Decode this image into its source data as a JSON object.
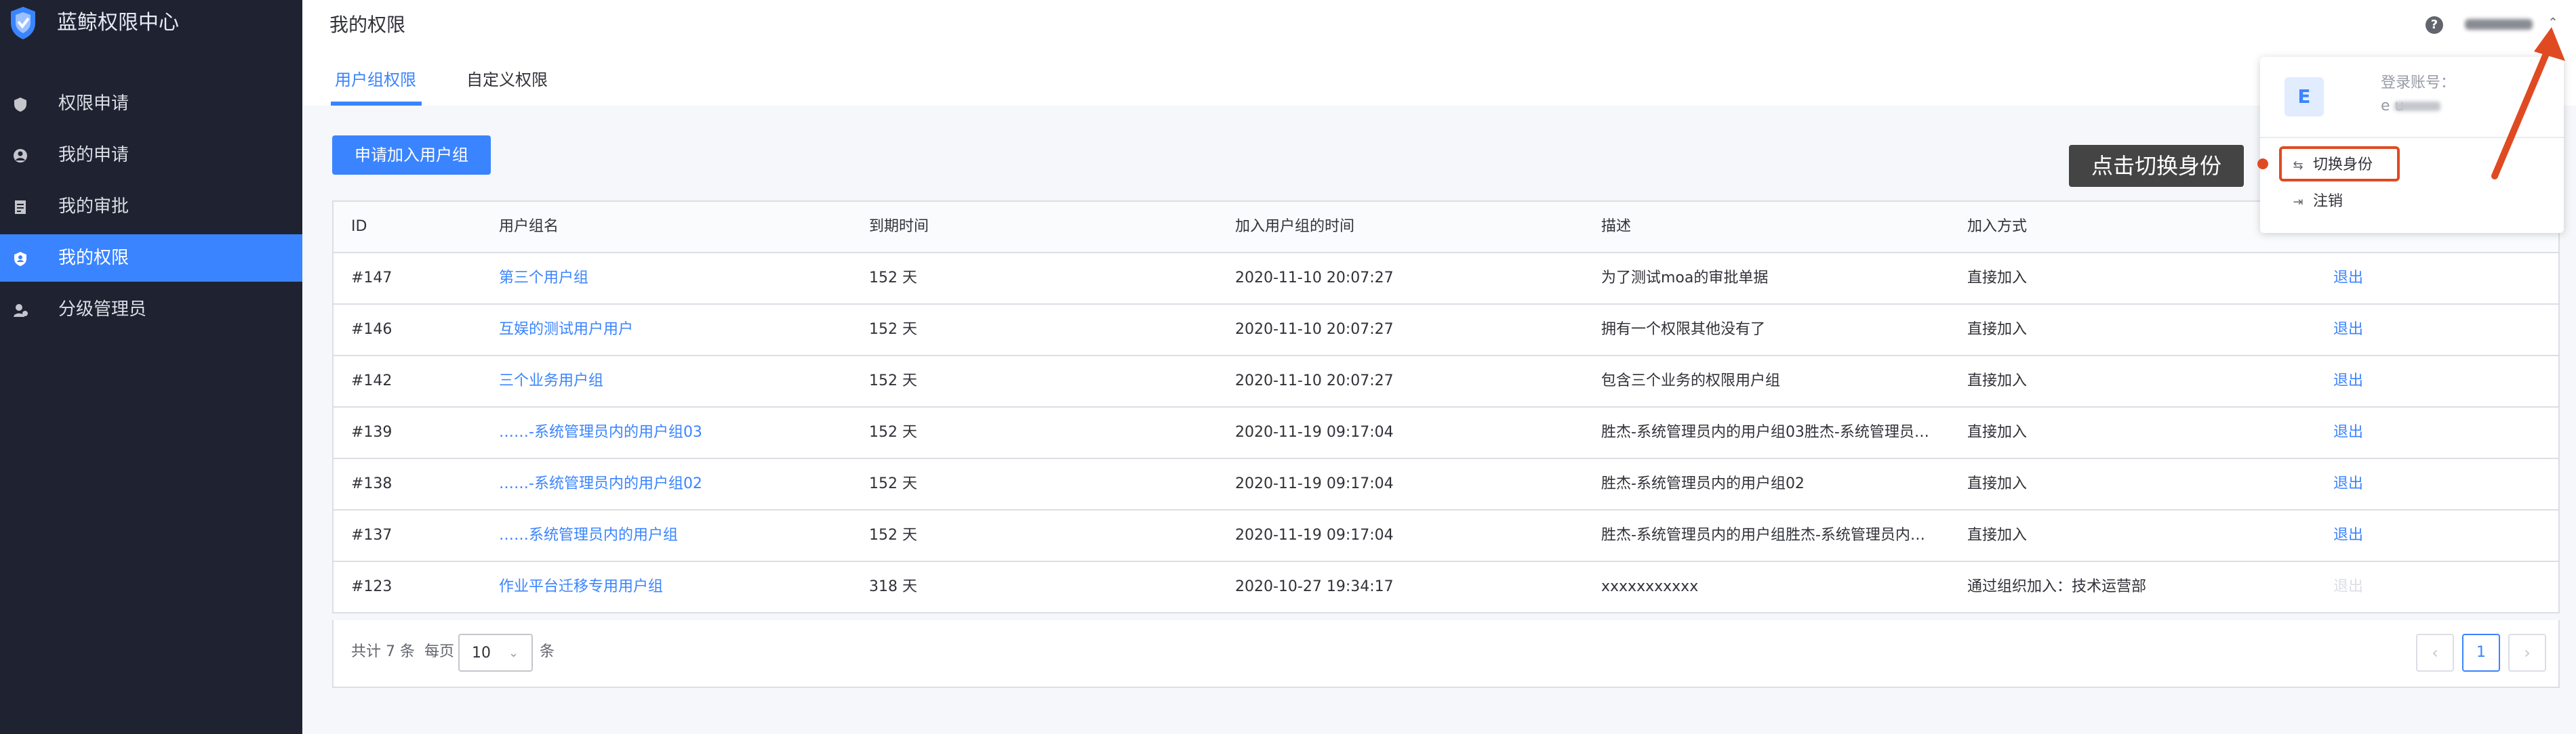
{
  "sidebar": {
    "brand_title": "蓝鲸权限中心",
    "items": [
      {
        "label": "权限申请",
        "icon": "shield-icon"
      },
      {
        "label": "我的申请",
        "icon": "user-circle-icon"
      },
      {
        "label": "我的审批",
        "icon": "document-icon"
      },
      {
        "label": "我的权限",
        "icon": "shield-user-icon",
        "active": true
      },
      {
        "label": "分级管理员",
        "icon": "admin-icon"
      }
    ]
  },
  "header": {
    "page_title": "我的权限",
    "tabs": [
      {
        "label": "用户组权限",
        "active": true
      },
      {
        "label": "自定义权限",
        "active": false
      }
    ],
    "help_glyph": "?"
  },
  "actions": {
    "apply_button": "申请加入用户组"
  },
  "table": {
    "columns": [
      "ID",
      "用户组名",
      "到期时间",
      "加入用户组的时间",
      "描述",
      "加入方式"
    ],
    "rows": [
      {
        "id": "#147",
        "name": "第三个用户组",
        "expire": "152 天",
        "joined": "2020-11-10 20:07:27",
        "desc": "为了测试moa的审批单据",
        "method": "直接加入",
        "action": "退出",
        "action_enabled": true
      },
      {
        "id": "#146",
        "name": "互娱的测试用户用户",
        "expire": "152 天",
        "joined": "2020-11-10 20:07:27",
        "desc": "拥有一个权限其他没有了",
        "method": "直接加入",
        "action": "退出",
        "action_enabled": true
      },
      {
        "id": "#142",
        "name": "三个业务用户组",
        "expire": "152 天",
        "joined": "2020-11-10 20:07:27",
        "desc": "包含三个业务的权限用户组",
        "method": "直接加入",
        "action": "退出",
        "action_enabled": true
      },
      {
        "id": "#139",
        "name": "……-系统管理员内的用户组03",
        "expire": "152 天",
        "joined": "2020-11-19 09:17:04",
        "desc": "胜杰-系统管理员内的用户组03胜杰-系统管理员…",
        "method": "直接加入",
        "action": "退出",
        "action_enabled": true
      },
      {
        "id": "#138",
        "name": "……-系统管理员内的用户组02",
        "expire": "152 天",
        "joined": "2020-11-19 09:17:04",
        "desc": "胜杰-系统管理员内的用户组02",
        "method": "直接加入",
        "action": "退出",
        "action_enabled": true
      },
      {
        "id": "#137",
        "name": "……系统管理员内的用户组",
        "expire": "152 天",
        "joined": "2020-11-19 09:17:04",
        "desc": "胜杰-系统管理员内的用户组胜杰-系统管理员内…",
        "method": "直接加入",
        "action": "退出",
        "action_enabled": true
      },
      {
        "id": "#123",
        "name": "作业平台迁移专用用户组",
        "expire": "318 天",
        "joined": "2020-10-27 19:34:17",
        "desc": "xxxxxxxxxxx",
        "method": "通过组织加入：技术运营部",
        "action": "退出",
        "action_enabled": false
      }
    ]
  },
  "pagination": {
    "total_prefix": "共计",
    "total_count": "7",
    "total_suffix": "条",
    "per_page_label": "每页",
    "page_size": "10",
    "unit": "条",
    "prev": "‹",
    "current_page": "1",
    "next": "›"
  },
  "user_menu": {
    "avatar_letter": "E",
    "login_label": "登录账号：",
    "login_value": "e        u",
    "items": [
      {
        "label": "切换身份",
        "icon": "switch-icon"
      },
      {
        "label": "注销",
        "icon": "logout-icon"
      }
    ]
  },
  "annotation": {
    "callout_text": "点击切换身份"
  },
  "colors": {
    "accent": "#3a84ff",
    "sidebar_bg": "#1e2231",
    "highlight_red": "#e04a22"
  }
}
